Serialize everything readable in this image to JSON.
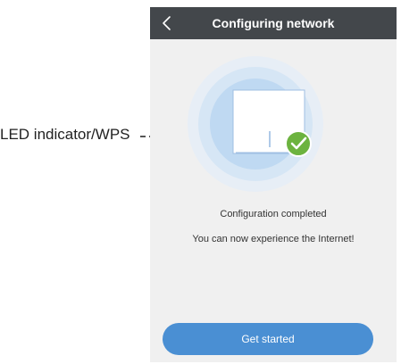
{
  "callout": {
    "label": "LED indicator/WPS"
  },
  "header": {
    "title": "Configuring network",
    "back_icon": "chevron-left-icon"
  },
  "status": {
    "line1": "Configuration completed",
    "line2": "You can now experience the Internet!",
    "success_icon": "check-circle-icon",
    "success_color": "#6cb33f"
  },
  "actions": {
    "primary_label": "Get started",
    "primary_color": "#4a8fd3"
  },
  "colors": {
    "header_bg": "#43474b",
    "screen_bg": "#f0f0f0"
  }
}
